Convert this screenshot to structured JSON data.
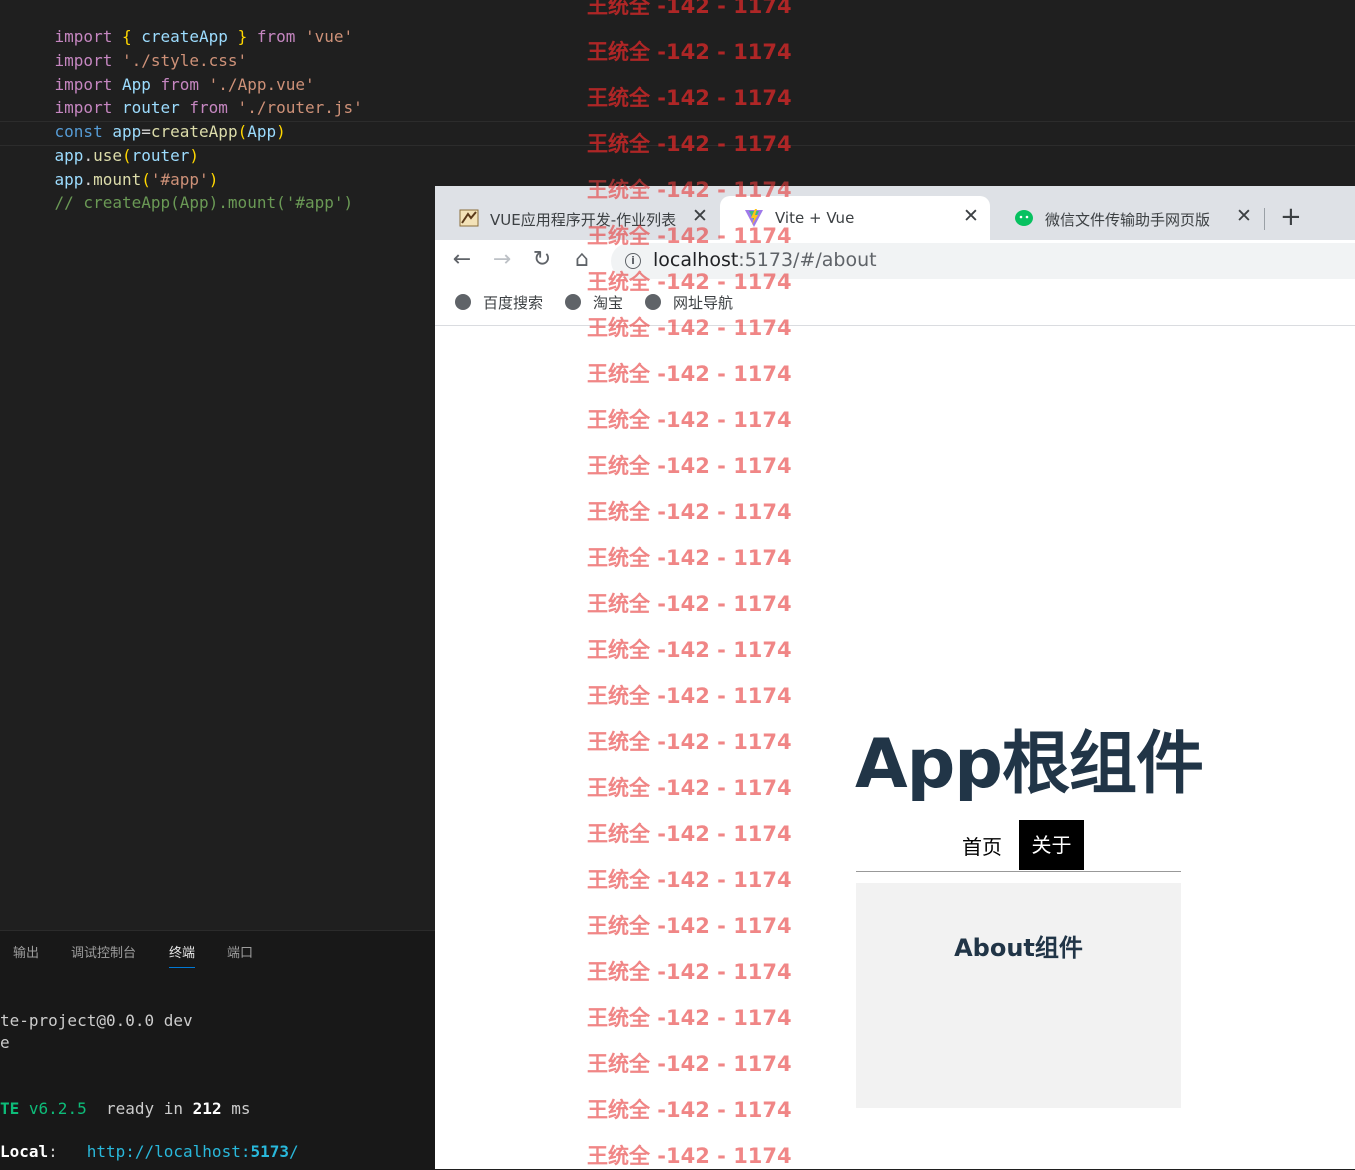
{
  "editor": {
    "lines": [
      {
        "p1": "import",
        "p2": " { ",
        "p3": "createApp",
        "p4": " } ",
        "p5": "from",
        "p6": " 'vue'"
      },
      {
        "p1": "import",
        "p2": " './style.css'"
      },
      {
        "p1": "import",
        "p2": " App ",
        "p3": "from",
        "p4": " './App.vue'"
      },
      {
        "p1": "import",
        "p2": " router ",
        "p3": "from",
        "p4": " './router.js'"
      },
      {
        "p1": "const",
        "p2": " app",
        "p3": "=",
        "p4": "createApp",
        "p5": "(",
        "p6": "App",
        "p7": ")"
      },
      {
        "p1": "app",
        "p2": ".",
        "p3": "use",
        "p4": "(",
        "p5": "router",
        "p6": ")"
      },
      {
        "p1": "app",
        "p2": ".",
        "p3": "mount",
        "p4": "(",
        "p5": "'#app'",
        "p6": ")"
      },
      {
        "p1": "// createApp(App).mount('#app')"
      }
    ]
  },
  "panel": {
    "tabs": [
      "输出",
      "调试控制台",
      "终端",
      "端口"
    ],
    "active_tab": "终端",
    "terminal": {
      "line1": "te-project@0.0.0 dev",
      "line2": "e",
      "vite_name": "TE",
      "vite_version": "v6.2.5",
      "ready_text": "ready in",
      "ready_ms": "212",
      "ready_unit": "ms",
      "local_label": "Local",
      "local_url_base": "http://localhost:",
      "local_port": "5173",
      "local_url_tail": "/"
    }
  },
  "browser": {
    "tabs": [
      {
        "title": "VUE应用程序开发-作业列表",
        "active": false
      },
      {
        "title": "Vite + Vue",
        "active": true
      },
      {
        "title": "微信文件传输助手网页版",
        "active": false
      }
    ],
    "new_tab_label": "+",
    "close_label": "✕",
    "nav": {
      "back": "←",
      "forward": "→",
      "reload": "↻",
      "home": "⌂"
    },
    "url_host": "localhost",
    "url_path": ":5173/#/about",
    "bookmarks": [
      "百度搜索",
      "淘宝",
      "网址导航"
    ]
  },
  "page": {
    "title": "App根组件",
    "nav_links": [
      "首页",
      "关于"
    ],
    "active_link": "关于",
    "component_title": "About组件"
  },
  "watermark": {
    "text": "王统全 -142 - 1174",
    "color": "#e63c3c"
  }
}
